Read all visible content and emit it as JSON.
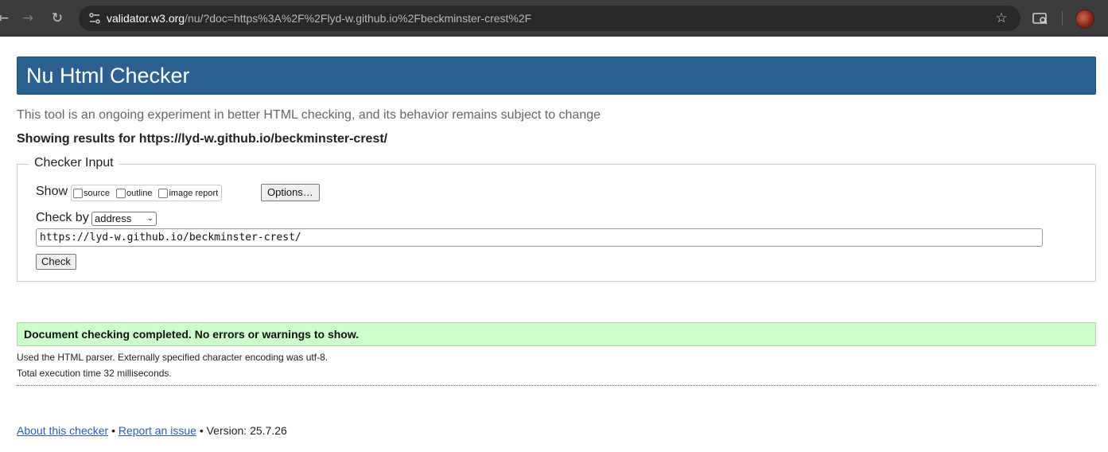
{
  "browser": {
    "url_host": "validator.w3.org",
    "url_rest": "/nu/?doc=https%3A%2F%2Flyd-w.github.io%2Fbeckminster-crest%2F",
    "icons": [
      "back-arrow-icon",
      "forward-arrow-icon",
      "reload-icon",
      "site-info-icon",
      "bookmark-star-icon",
      "search-tabs-icon",
      "profile-avatar"
    ]
  },
  "header": {
    "title": "Nu Html Checker",
    "tagline": "This tool is an ongoing experiment in better HTML checking, and its behavior remains subject to change",
    "results_for": "Showing results for https://lyd-w.github.io/beckminster-crest/"
  },
  "checker_input": {
    "legend": "Checker Input",
    "show_label": "Show",
    "show_options": [
      {
        "label": "source",
        "checked": false
      },
      {
        "label": "outline",
        "checked": false
      },
      {
        "label": "image report",
        "checked": false
      }
    ],
    "options_button": "Options…",
    "check_by_label": "Check by",
    "check_by_value": "address",
    "url_value": "https://lyd-w.github.io/beckminster-crest/",
    "check_button": "Check"
  },
  "results": {
    "success_message": "Document checking completed. No errors or warnings to show.",
    "parser_info": "Used the HTML parser. Externally specified character encoding was utf-8.",
    "execution_time": "Total execution time 32 milliseconds."
  },
  "footer": {
    "about_link": "About this checker",
    "separator": "•",
    "report_link": "Report an issue",
    "version": "Version: 25.7.26"
  },
  "colors": {
    "header_bg": "#2c6090",
    "success_bg": "#ccffcc",
    "link": "#2a5db0"
  }
}
